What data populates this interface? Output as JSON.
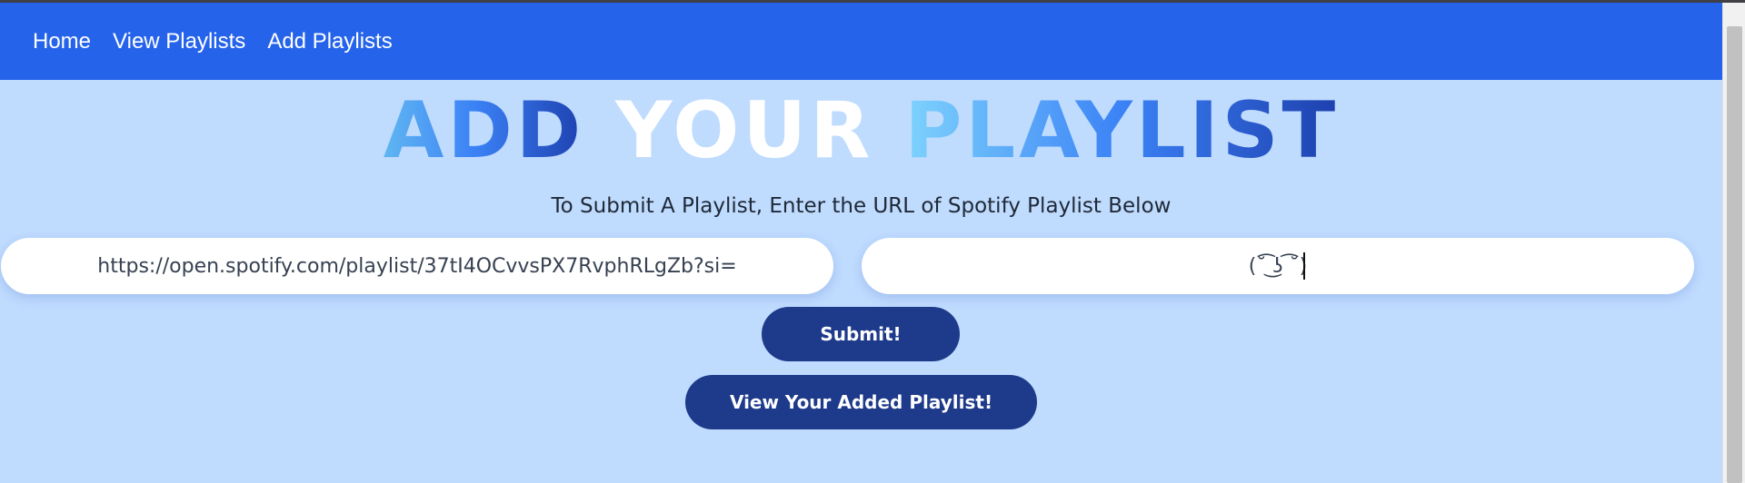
{
  "nav": {
    "items": [
      {
        "label": "Home"
      },
      {
        "label": "View Playlists"
      },
      {
        "label": "Add Playlists"
      }
    ]
  },
  "hero": {
    "word1": "ADD",
    "word2": "YOUR",
    "word3": "PLAYLIST"
  },
  "subtitle": "To Submit A Playlist, Enter the URL of Spotify Playlist Below",
  "form": {
    "url_value": "https://open.spotify.com/playlist/37tI4OCvvsPX7RvphRLgZb?si=",
    "name_value": "(˘͡ ͜ʖ ͡˘)",
    "submit_label": "Submit!",
    "view_label": "View Your Added Playlist!"
  },
  "colors": {
    "navbar": "#2563eb",
    "background": "#bfdbfe",
    "button": "#1e3a8a"
  }
}
